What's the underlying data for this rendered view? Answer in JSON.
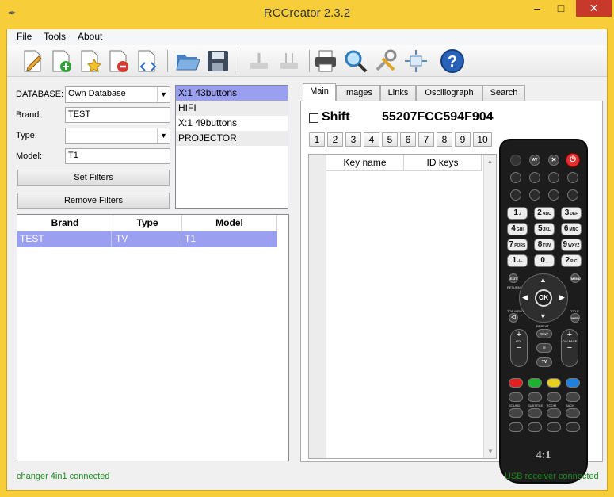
{
  "window": {
    "title": "RCCreator 2.3.2",
    "controls": {
      "min": "–",
      "max": "□",
      "close": "✕"
    }
  },
  "menu": [
    "File",
    "Tools",
    "About"
  ],
  "filters": {
    "database_label": "DATABASE:",
    "database_value": "Own Database",
    "brand_label": "Brand:",
    "brand_value": "TEST",
    "type_label": "Type:",
    "type_value": "",
    "model_label": "Model:",
    "model_value": "T1",
    "set_filters": "Set Filters",
    "remove_filters": "Remove Filters"
  },
  "categories": [
    {
      "label": "X:1 43buttons",
      "state": "selected"
    },
    {
      "label": "HIFI",
      "state": "shaded"
    },
    {
      "label": "X:1 49buttons",
      "state": "normal"
    },
    {
      "label": "PROJECTOR",
      "state": "shaded"
    }
  ],
  "devices": {
    "columns": [
      "Brand",
      "Type",
      "Model"
    ],
    "rows": [
      [
        "TEST",
        "TV",
        "T1"
      ]
    ]
  },
  "tabs": [
    "Main",
    "Images",
    "Links",
    "Oscillograph",
    "Search"
  ],
  "main": {
    "shift_label": "Shift",
    "code": "55207FCC594F904",
    "numbers": [
      "1",
      "2",
      "3",
      "4",
      "5",
      "6",
      "7",
      "8",
      "9",
      "10"
    ],
    "key_columns": [
      "Key name",
      "ID keys"
    ]
  },
  "remote": {
    "brand": "4:1",
    "digits": [
      [
        "1",
        "./"
      ],
      [
        "2",
        "ABC"
      ],
      [
        "3",
        "DEF"
      ],
      [
        "4",
        "GHI"
      ],
      [
        "5",
        "JKL"
      ],
      [
        "6",
        "MNO"
      ],
      [
        "7",
        "PQRS"
      ],
      [
        "8",
        "TUV"
      ],
      [
        "9",
        "WXYZ"
      ],
      [
        "1",
        "-/--"
      ],
      [
        "0",
        "_"
      ],
      [
        "2",
        "P/C"
      ]
    ],
    "nav": {
      "ok": "OK",
      "exit": "EXIT",
      "menu": "MENU",
      "return": "RETURN",
      "title": "TITLE",
      "top_menu": "TOP MENU",
      "info": "INFO",
      "repeat": "REPEAT",
      "text": "TEXT"
    },
    "vol": "VOL",
    "ch": "CH/ PAGE",
    "tv": "TV",
    "sound_labels": [
      "SOUND",
      "SUBTITLE",
      "ZOOM",
      "BACK"
    ],
    "colors": {
      "red": "#e02020",
      "green": "#20b030",
      "yellow": "#e8d020",
      "blue": "#2080e0",
      "power": "#e03030"
    }
  },
  "status": {
    "left": "changer 4in1 connected",
    "right": "USB receiver connected"
  }
}
